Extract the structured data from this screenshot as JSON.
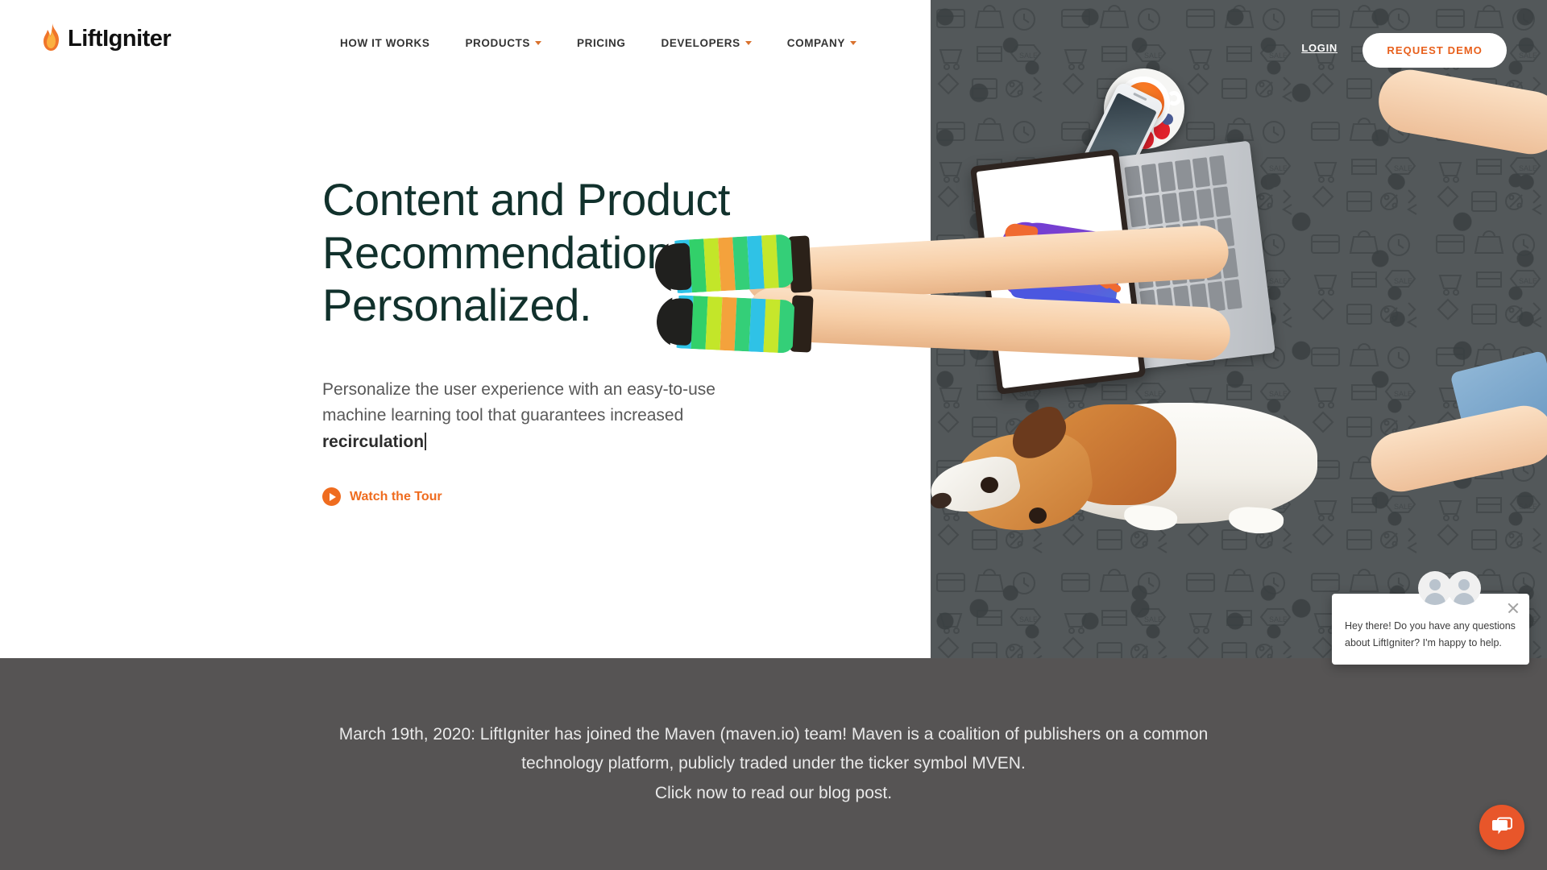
{
  "brand": {
    "name": "LiftIgniter",
    "logo_icon": "flame-icon",
    "accent_orange": "#ef6c1f",
    "headline_teal": "#11312c",
    "banner_gray": "#565454"
  },
  "header": {
    "nav": [
      {
        "label": "HOW IT WORKS",
        "has_caret": false
      },
      {
        "label": "PRODUCTS",
        "has_caret": true
      },
      {
        "label": "PRICING",
        "has_caret": false
      },
      {
        "label": "DEVELOPERS",
        "has_caret": true
      },
      {
        "label": "COMPANY",
        "has_caret": true
      }
    ],
    "login_label": "LOGIN",
    "demo_label": "REQUEST DEMO"
  },
  "hero": {
    "headline_line1": "Content and Product",
    "headline_line2": "Recommendations.",
    "headline_line3": "Personalized.",
    "subcopy_prefix": "Personalize the user experience with an easy-to-use machine learning tool that guarantees increased ",
    "subcopy_typed": "recirculation",
    "watch_label": "Watch the Tour",
    "play_icon": "play-icon"
  },
  "banner": {
    "line1": "March 19th, 2020: LiftIgniter has joined the Maven (maven.io) team! Maven is a coalition of publishers on a common",
    "line2": "technology platform, publicly traded under the ticker symbol MVEN.",
    "line3": "Click now to read our blog post."
  },
  "chat": {
    "message": "Hey there! Do you have any questions about LiftIgniter? I'm happy to help.",
    "close_icon": "close-icon",
    "avatar_icon": "avatar-icon",
    "fab_icon": "chat-bubble-icon"
  }
}
